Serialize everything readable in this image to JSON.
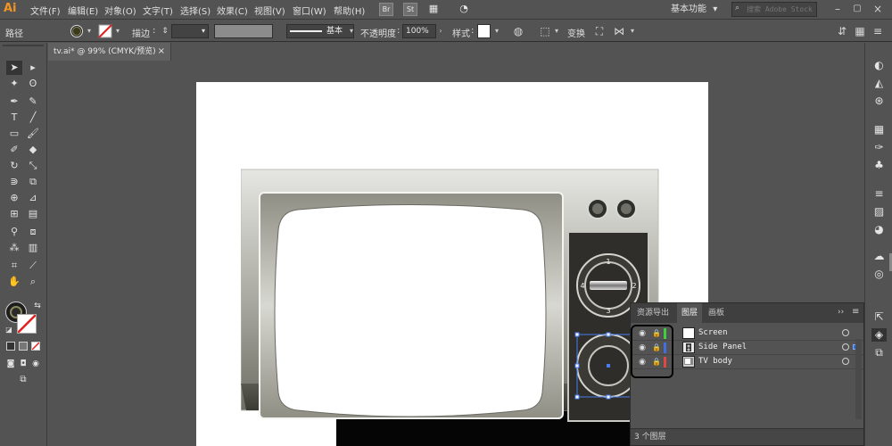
{
  "app": {
    "logo": "Ai"
  },
  "menu": [
    "文件(F)",
    "编辑(E)",
    "对象(O)",
    "文字(T)",
    "选择(S)",
    "效果(C)",
    "视图(V)",
    "窗口(W)",
    "帮助(H)"
  ],
  "menubar_icons": {
    "bridge": "Br",
    "stock": "St"
  },
  "workspace": {
    "label": "基本功能"
  },
  "search": {
    "placeholder": "搜索 Adobe Stock"
  },
  "control_bar": {
    "selection_label": "路径",
    "stroke_label": "描边",
    "brush_label": "基本",
    "opacity_label": "不透明度",
    "opacity_value": "100%",
    "style_label": "样式",
    "transform_label": "变换"
  },
  "document": {
    "tab_title": "tv.ai* @ 99% (CMYK/预览)",
    "tab_close": "×"
  },
  "tv": {
    "dial_top": {
      "labels": [
        "1",
        "2",
        "3",
        "4"
      ]
    }
  },
  "layers_panel": {
    "tabs": [
      "资源导出",
      "图层",
      "画板"
    ],
    "active_tab": "图层",
    "layers": [
      {
        "name": "Screen",
        "color": "#3fcf3f"
      },
      {
        "name": "Side Panel",
        "color": "#3f6fe0"
      },
      {
        "name": "TV body",
        "color": "#e04848"
      }
    ],
    "footer": "3 个图层"
  },
  "colors": {
    "ui_bg": "#535353",
    "accent": "#f29424",
    "selection": "#2e6fd8"
  }
}
